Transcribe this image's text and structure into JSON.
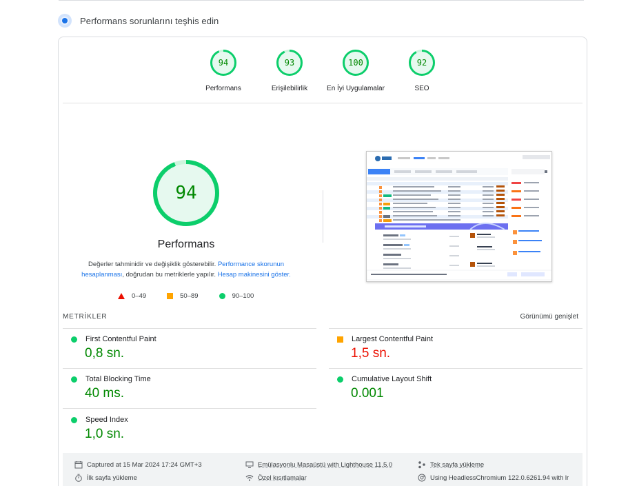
{
  "section": {
    "title": "Performans sorunlarını teşhis edin"
  },
  "scores": [
    {
      "value": "94",
      "label": "Performans"
    },
    {
      "value": "93",
      "label": "Erişilebilirlik"
    },
    {
      "value": "100",
      "label": "En İyi Uygulamalar"
    },
    {
      "value": "92",
      "label": "SEO"
    }
  ],
  "main_gauge": {
    "value": "94",
    "title": "Performans",
    "desc_1": "Değerler tahminidir ve değişiklik gösterebilir.",
    "desc_link_1": "Performance skorunun hesaplanması",
    "desc_2": ", doğrudan bu metriklerle yapılır.",
    "desc_link_2": "Hesap makinesini göster."
  },
  "legend": {
    "fail": "0–49",
    "average": "50–89",
    "pass": "90–100"
  },
  "metrics": {
    "title": "METRİKLER",
    "expand_label": "Görünümü genişlet",
    "fcp": {
      "name": "First Contentful Paint",
      "value": "0,8 sn."
    },
    "lcp": {
      "name": "Largest Contentful Paint",
      "value": "1,5 sn."
    },
    "tbt": {
      "name": "Total Blocking Time",
      "value": "40 ms."
    },
    "cls": {
      "name": "Cumulative Layout Shift",
      "value": "0.001"
    },
    "si": {
      "name": "Speed Index",
      "value": "1,0 sn."
    }
  },
  "footer": {
    "captured": "Captured at 15 Mar 2024 17:24 GMT+3",
    "emulation": "Emülasyonlu Masaüstü with Lighthouse 11.5.0",
    "single_page": "Tek sayfa yükleme",
    "initial_load": "İlk sayfa yükleme",
    "throttling": "Özel kısıtlamalar",
    "browser": "Using HeadlessChromium 122.0.6261.94 with lr"
  },
  "colors": {
    "pass": "#0cce6b",
    "pass_text": "#008800",
    "average": "#ffa400",
    "fail": "#eb0f00",
    "link": "#1a73e8"
  }
}
